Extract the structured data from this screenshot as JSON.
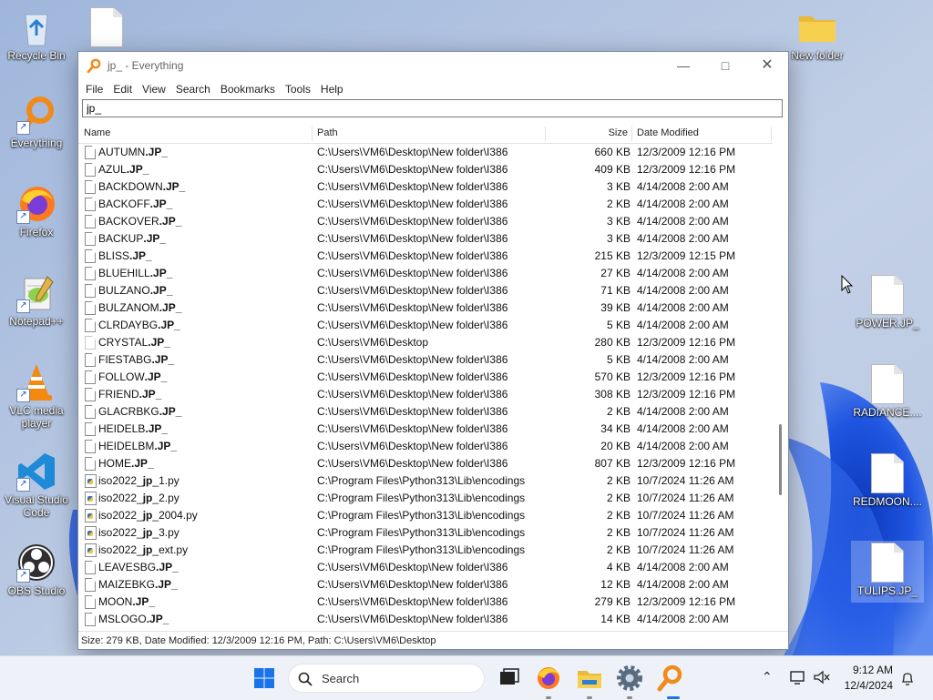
{
  "desktop": {
    "icons_left": [
      {
        "label": "Recycle Bin",
        "icon": "recycle-bin-icon"
      },
      {
        "label": "Everything",
        "icon": "everything-icon"
      },
      {
        "label": "Firefox",
        "icon": "firefox-icon"
      },
      {
        "label": "Notepad++",
        "icon": "notepadpp-icon"
      },
      {
        "label": "VLC media player",
        "icon": "vlc-icon"
      },
      {
        "label": "Visual Studio Code",
        "icon": "vscode-icon"
      },
      {
        "label": "OBS Studio",
        "icon": "obs-icon"
      }
    ],
    "icons_right": [
      {
        "label": "New folder",
        "icon": "folder-icon"
      },
      {
        "label": "POWER.JP_",
        "icon": "file-icon"
      },
      {
        "label": "RADIANCE....",
        "icon": "file-icon"
      },
      {
        "label": "REDMOON....",
        "icon": "file-icon"
      },
      {
        "label": "TULIPS.JP_",
        "icon": "file-icon"
      }
    ]
  },
  "window": {
    "title": "jp_ - Everything",
    "menu": [
      "File",
      "Edit",
      "View",
      "Search",
      "Bookmarks",
      "Tools",
      "Help"
    ],
    "search_value": "jp_",
    "columns": {
      "name": "Name",
      "path": "Path",
      "size": "Size",
      "date": "Date Modified"
    },
    "rows": [
      {
        "pre": "AUTUMN",
        "hl": ".JP_",
        "post": "",
        "path": "C:\\Users\\VM6\\Desktop\\New folder\\I386",
        "size": "660 KB",
        "date": "12/3/2009 12:16 PM",
        "type": "doc"
      },
      {
        "pre": "AZUL",
        "hl": ".JP_",
        "post": "",
        "path": "C:\\Users\\VM6\\Desktop\\New folder\\I386",
        "size": "409 KB",
        "date": "12/3/2009 12:16 PM",
        "type": "doc"
      },
      {
        "pre": "BACKDOWN",
        "hl": ".JP_",
        "post": "",
        "path": "C:\\Users\\VM6\\Desktop\\New folder\\I386",
        "size": "3 KB",
        "date": "4/14/2008 2:00 AM",
        "type": "doc"
      },
      {
        "pre": "BACKOFF",
        "hl": ".JP_",
        "post": "",
        "path": "C:\\Users\\VM6\\Desktop\\New folder\\I386",
        "size": "2 KB",
        "date": "4/14/2008 2:00 AM",
        "type": "doc"
      },
      {
        "pre": "BACKOVER",
        "hl": ".JP_",
        "post": "",
        "path": "C:\\Users\\VM6\\Desktop\\New folder\\I386",
        "size": "3 KB",
        "date": "4/14/2008 2:00 AM",
        "type": "doc"
      },
      {
        "pre": "BACKUP",
        "hl": ".JP_",
        "post": "",
        "path": "C:\\Users\\VM6\\Desktop\\New folder\\I386",
        "size": "3 KB",
        "date": "4/14/2008 2:00 AM",
        "type": "doc"
      },
      {
        "pre": "BLISS",
        "hl": ".JP_",
        "post": "",
        "path": "C:\\Users\\VM6\\Desktop\\New folder\\I386",
        "size": "215 KB",
        "date": "12/3/2009 12:15 PM",
        "type": "doc"
      },
      {
        "pre": "BLUEHILL",
        "hl": ".JP_",
        "post": "",
        "path": "C:\\Users\\VM6\\Desktop\\New folder\\I386",
        "size": "27 KB",
        "date": "4/14/2008 2:00 AM",
        "type": "doc"
      },
      {
        "pre": "BULZANO",
        "hl": ".JP_",
        "post": "",
        "path": "C:\\Users\\VM6\\Desktop\\New folder\\I386",
        "size": "71 KB",
        "date": "4/14/2008 2:00 AM",
        "type": "doc"
      },
      {
        "pre": "BULZANOM",
        "hl": ".JP_",
        "post": "",
        "path": "C:\\Users\\VM6\\Desktop\\New folder\\I386",
        "size": "39 KB",
        "date": "4/14/2008 2:00 AM",
        "type": "doc"
      },
      {
        "pre": "CLRDAYBG",
        "hl": ".JP_",
        "post": "",
        "path": "C:\\Users\\VM6\\Desktop\\New folder\\I386",
        "size": "5 KB",
        "date": "4/14/2008 2:00 AM",
        "type": "doc"
      },
      {
        "pre": "CRYSTAL",
        "hl": ".JP_",
        "post": "",
        "path": "C:\\Users\\VM6\\Desktop",
        "size": "280 KB",
        "date": "12/3/2009 12:16 PM",
        "type": "doc-faint"
      },
      {
        "pre": "FIESTABG",
        "hl": ".JP_",
        "post": "",
        "path": "C:\\Users\\VM6\\Desktop\\New folder\\I386",
        "size": "5 KB",
        "date": "4/14/2008 2:00 AM",
        "type": "doc"
      },
      {
        "pre": "FOLLOW",
        "hl": ".JP_",
        "post": "",
        "path": "C:\\Users\\VM6\\Desktop\\New folder\\I386",
        "size": "570 KB",
        "date": "12/3/2009 12:16 PM",
        "type": "doc"
      },
      {
        "pre": "FRIEND",
        "hl": ".JP_",
        "post": "",
        "path": "C:\\Users\\VM6\\Desktop\\New folder\\I386",
        "size": "308 KB",
        "date": "12/3/2009 12:16 PM",
        "type": "doc"
      },
      {
        "pre": "GLACRBKG",
        "hl": ".JP_",
        "post": "",
        "path": "C:\\Users\\VM6\\Desktop\\New folder\\I386",
        "size": "2 KB",
        "date": "4/14/2008 2:00 AM",
        "type": "doc"
      },
      {
        "pre": "HEIDELB",
        "hl": ".JP_",
        "post": "",
        "path": "C:\\Users\\VM6\\Desktop\\New folder\\I386",
        "size": "34 KB",
        "date": "4/14/2008 2:00 AM",
        "type": "doc"
      },
      {
        "pre": "HEIDELBM",
        "hl": ".JP_",
        "post": "",
        "path": "C:\\Users\\VM6\\Desktop\\New folder\\I386",
        "size": "20 KB",
        "date": "4/14/2008 2:00 AM",
        "type": "doc"
      },
      {
        "pre": "HOME",
        "hl": ".JP_",
        "post": "",
        "path": "C:\\Users\\VM6\\Desktop\\New folder\\I386",
        "size": "807 KB",
        "date": "12/3/2009 12:16 PM",
        "type": "doc"
      },
      {
        "pre": "iso2022_",
        "hl": "jp",
        "post": "_1.py",
        "path": "C:\\Program Files\\Python313\\Lib\\encodings",
        "size": "2 KB",
        "date": "10/7/2024 11:26 AM",
        "type": "py"
      },
      {
        "pre": "iso2022_",
        "hl": "jp",
        "post": "_2.py",
        "path": "C:\\Program Files\\Python313\\Lib\\encodings",
        "size": "2 KB",
        "date": "10/7/2024 11:26 AM",
        "type": "py"
      },
      {
        "pre": "iso2022_",
        "hl": "jp",
        "post": "_2004.py",
        "path": "C:\\Program Files\\Python313\\Lib\\encodings",
        "size": "2 KB",
        "date": "10/7/2024 11:26 AM",
        "type": "py"
      },
      {
        "pre": "iso2022_",
        "hl": "jp",
        "post": "_3.py",
        "path": "C:\\Program Files\\Python313\\Lib\\encodings",
        "size": "2 KB",
        "date": "10/7/2024 11:26 AM",
        "type": "py"
      },
      {
        "pre": "iso2022_",
        "hl": "jp",
        "post": "_ext.py",
        "path": "C:\\Program Files\\Python313\\Lib\\encodings",
        "size": "2 KB",
        "date": "10/7/2024 11:26 AM",
        "type": "py"
      },
      {
        "pre": "LEAVESBG",
        "hl": ".JP_",
        "post": "",
        "path": "C:\\Users\\VM6\\Desktop\\New folder\\I386",
        "size": "4 KB",
        "date": "4/14/2008 2:00 AM",
        "type": "doc"
      },
      {
        "pre": "MAIZEBKG",
        "hl": ".JP_",
        "post": "",
        "path": "C:\\Users\\VM6\\Desktop\\New folder\\I386",
        "size": "12 KB",
        "date": "4/14/2008 2:00 AM",
        "type": "doc"
      },
      {
        "pre": "MOON",
        "hl": ".JP_",
        "post": "",
        "path": "C:\\Users\\VM6\\Desktop\\New folder\\I386",
        "size": "279 KB",
        "date": "12/3/2009 12:16 PM",
        "type": "doc"
      },
      {
        "pre": "MSLOGO",
        "hl": ".JP_",
        "post": "",
        "path": "C:\\Users\\VM6\\Desktop\\New folder\\I386",
        "size": "14 KB",
        "date": "4/14/2008 2:00 AM",
        "type": "doc"
      }
    ],
    "status": "Size: 279 KB, Date Modified: 12/3/2009 12:16 PM, Path: C:\\Users\\VM6\\Desktop"
  },
  "taskbar": {
    "search_label": "Search",
    "apps": [
      "windows-start-icon",
      "task-view-icon",
      "firefox-icon",
      "file-explorer-icon",
      "settings-icon",
      "everything-icon"
    ],
    "time": "9:12 AM",
    "date": "12/4/2024"
  },
  "colors": {
    "accent": "#1c5fc4",
    "wallpaper": "#aebfdc",
    "bloom": "#1f4fd6",
    "everything_orange": "#f08a1c"
  }
}
